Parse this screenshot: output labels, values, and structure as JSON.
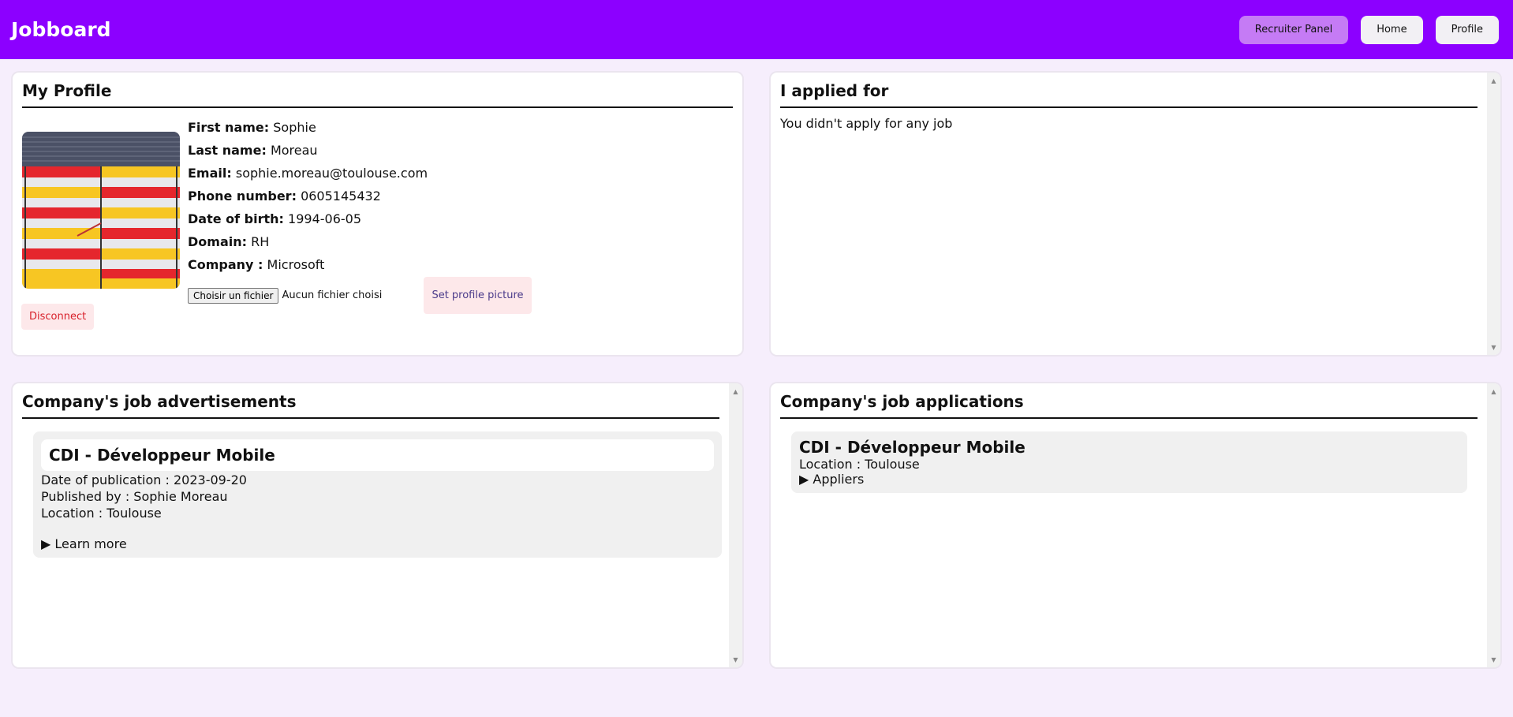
{
  "header": {
    "brand": "Jobboard",
    "nav": [
      "Recruiter Panel",
      "Home",
      "Profile"
    ]
  },
  "profile": {
    "title": "My Profile",
    "fields": [
      {
        "label": "First name:",
        "value": "Sophie"
      },
      {
        "label": "Last name:",
        "value": "Moreau"
      },
      {
        "label": "Email:",
        "value": "sophie.moreau@toulouse.com"
      },
      {
        "label": "Phone number:",
        "value": "0605145432"
      },
      {
        "label": "Date of birth:",
        "value": "1994-06-05"
      },
      {
        "label": "Domain:",
        "value": "RH"
      },
      {
        "label": "Company :",
        "value": "Microsoft"
      }
    ],
    "file_button": "Choisir un fichier",
    "file_status": "Aucun fichier choisi",
    "set_picture": "Set profile picture",
    "disconnect": "Disconnect"
  },
  "applied": {
    "title": "I applied for",
    "empty": "You didn't apply for any job"
  },
  "ads": {
    "title": "Company's job advertisements",
    "jobs": [
      {
        "title": "CDI - Développeur Mobile",
        "date": "Date of publication : 2023-09-20",
        "publisher": "Published by : Sophie Moreau",
        "location": "Location : Toulouse",
        "details": "Learn more"
      }
    ]
  },
  "applications": {
    "title": "Company's job applications",
    "jobs": [
      {
        "title": "CDI - Développeur Mobile",
        "location": "Location : Toulouse",
        "details": "Appliers"
      }
    ]
  },
  "colors": {
    "header": "#8c00ff",
    "background": "#f6eefc",
    "accent_button": "#c57bf5",
    "danger_text": "#d8202a"
  }
}
